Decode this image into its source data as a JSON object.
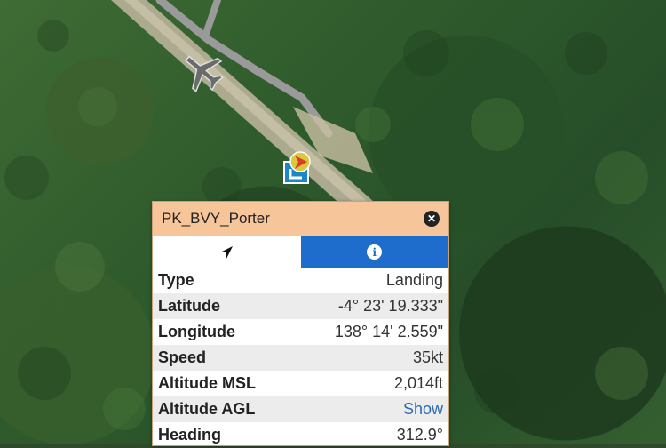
{
  "popup": {
    "title": "PK_BVY_Porter",
    "tabs": [
      {
        "icon": "navigation-arrow-icon"
      },
      {
        "icon": "info-icon",
        "glyph": "i",
        "active": true
      }
    ],
    "rows": [
      {
        "label": "Type",
        "value": "Landing"
      },
      {
        "label": "Latitude",
        "value": "-4° 23' 19.333\""
      },
      {
        "label": "Longitude",
        "value": "138° 14' 2.559\""
      },
      {
        "label": "Speed",
        "value": "35kt"
      },
      {
        "label": "Altitude MSL",
        "value": "2,014ft"
      },
      {
        "label": "Altitude AGL",
        "value": "Show"
      },
      {
        "label": "Heading",
        "value": "312.9°"
      }
    ]
  },
  "colors": {
    "header_bg": "#f7c59a",
    "tab_active": "#1e6ccc",
    "link": "#2b6cb0"
  }
}
